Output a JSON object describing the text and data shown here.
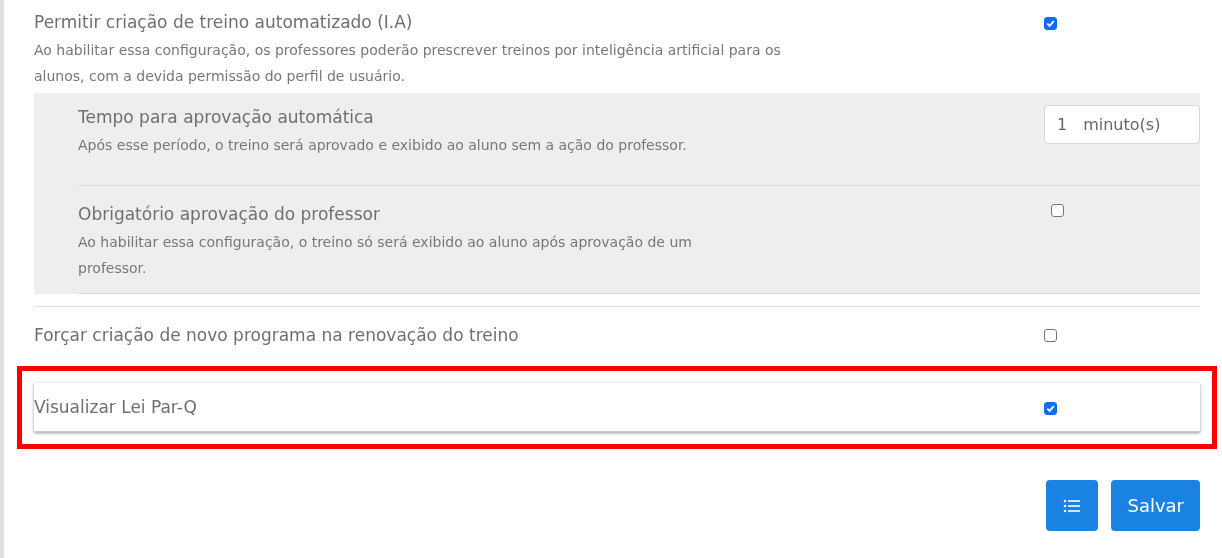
{
  "settings": [
    {
      "kind": "checkbox",
      "title": "Permitir criação de treino automatizado (I.A)",
      "description": "Ao habilitar essa configuração, os professores poderão prescrever treinos por inteligência artificial para os alunos, com a devida permissão do perfil de usuário.",
      "checked": true,
      "highlighted": false,
      "children": [
        {
          "kind": "number",
          "title": "Tempo para aprovação automática",
          "description": "Após esse período, o treino será aprovado e exibido ao aluno sem a ação do professor.",
          "value": "1",
          "unit": "minuto(s)"
        },
        {
          "kind": "checkbox",
          "title": "Obrigatório aprovação do professor",
          "description": "Ao habilitar essa configuração, o treino só será exibido ao aluno após aprovação de um professor.",
          "checked": false
        }
      ]
    },
    {
      "kind": "checkbox",
      "title": "Forçar criação de novo programa na renovação do treino",
      "checked": false,
      "highlighted": false
    },
    {
      "kind": "checkbox",
      "title": "Visualizar Lei Par-Q",
      "checked": true,
      "highlighted": true
    }
  ],
  "save_button": "Salvar"
}
